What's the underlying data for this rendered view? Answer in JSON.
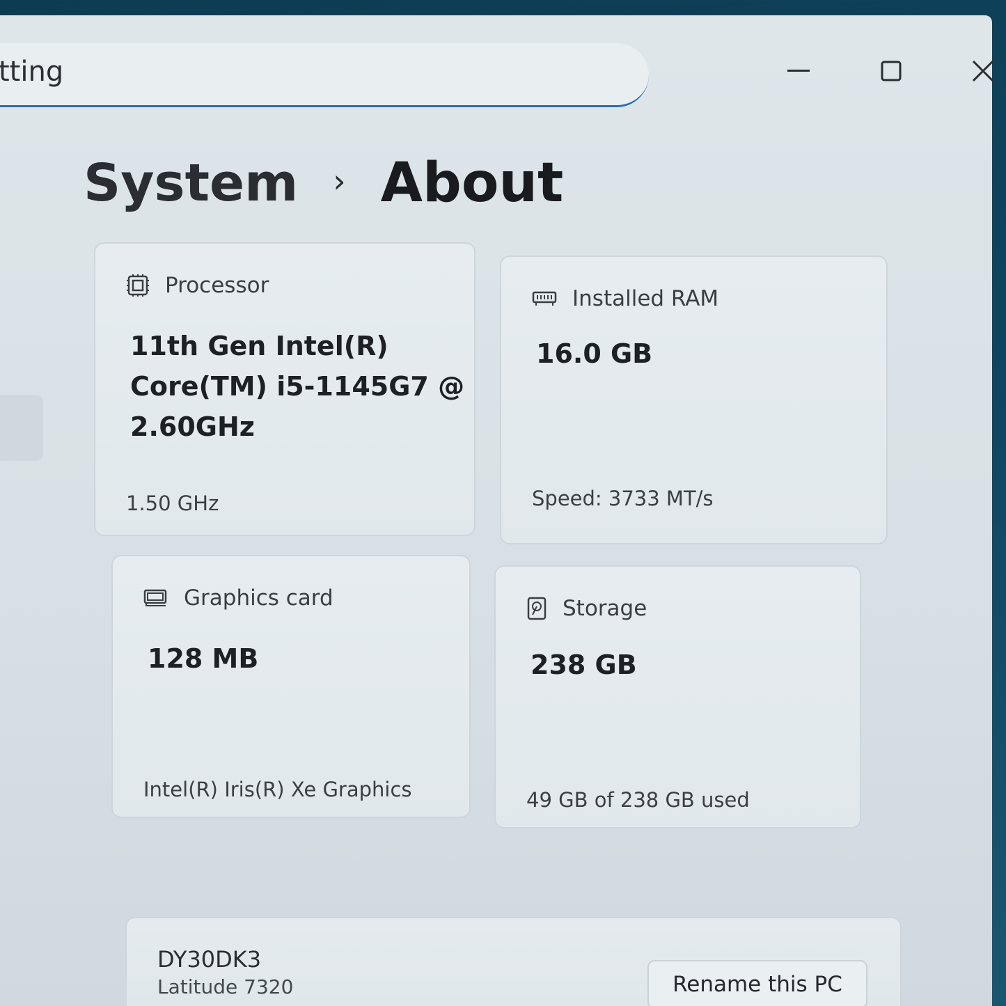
{
  "search": {
    "value": "tting"
  },
  "window_controls": {
    "minimize_icon": "minimize-icon",
    "maximize_icon": "maximize-icon",
    "close_icon": "close-icon"
  },
  "breadcrumb": {
    "parent": "System",
    "separator": "›",
    "current": "About"
  },
  "specs": {
    "processor": {
      "icon": "processor-icon",
      "title": "Processor",
      "value_lines": [
        "11th Gen Intel(R)",
        "Core(TM) i5-1145G7 @",
        "2.60GHz"
      ],
      "sub": "1.50 GHz"
    },
    "ram": {
      "icon": "ram-icon",
      "title": "Installed RAM",
      "value": "16.0 GB",
      "sub": "Speed: 3733 MT/s"
    },
    "graphics": {
      "icon": "graphics-card-icon",
      "title": "Graphics card",
      "value": "128 MB",
      "sub": "Intel(R) Iris(R) Xe Graphics"
    },
    "storage": {
      "icon": "storage-icon",
      "title": "Storage",
      "value": "238 GB",
      "sub": "49 GB of 238 GB used"
    }
  },
  "device": {
    "name": "DY30DK3",
    "model": "Latitude 7320",
    "rename_label": "Rename this PC"
  },
  "colors": {
    "accent": "#2a6fb0",
    "window_bg": "#dfe6ea",
    "card_bg": "#e6ecef"
  }
}
